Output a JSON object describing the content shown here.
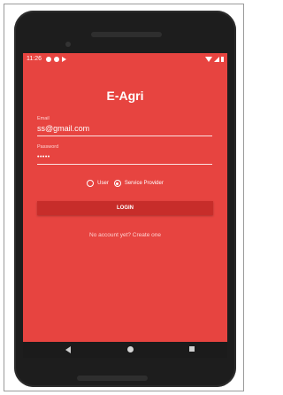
{
  "status_bar": {
    "time": "11:26",
    "icons_left": [
      "settings-icon",
      "sync-icon",
      "play-icon"
    ],
    "icons_right": [
      "wifi-icon",
      "signal-icon",
      "battery-icon"
    ]
  },
  "app": {
    "title": "E-Agri"
  },
  "form": {
    "email_label": "Email",
    "email_value": "ss@gmail.com",
    "password_label": "Password",
    "password_value": "•••••",
    "role_options": [
      "User",
      "Service Provider"
    ],
    "selected_role": "Service Provider",
    "login_label": "LOGIN",
    "signup_link": "No account yet? Create one"
  },
  "colors": {
    "background": "#e74440",
    "button": "#c72d2a",
    "text": "#ffffff"
  }
}
